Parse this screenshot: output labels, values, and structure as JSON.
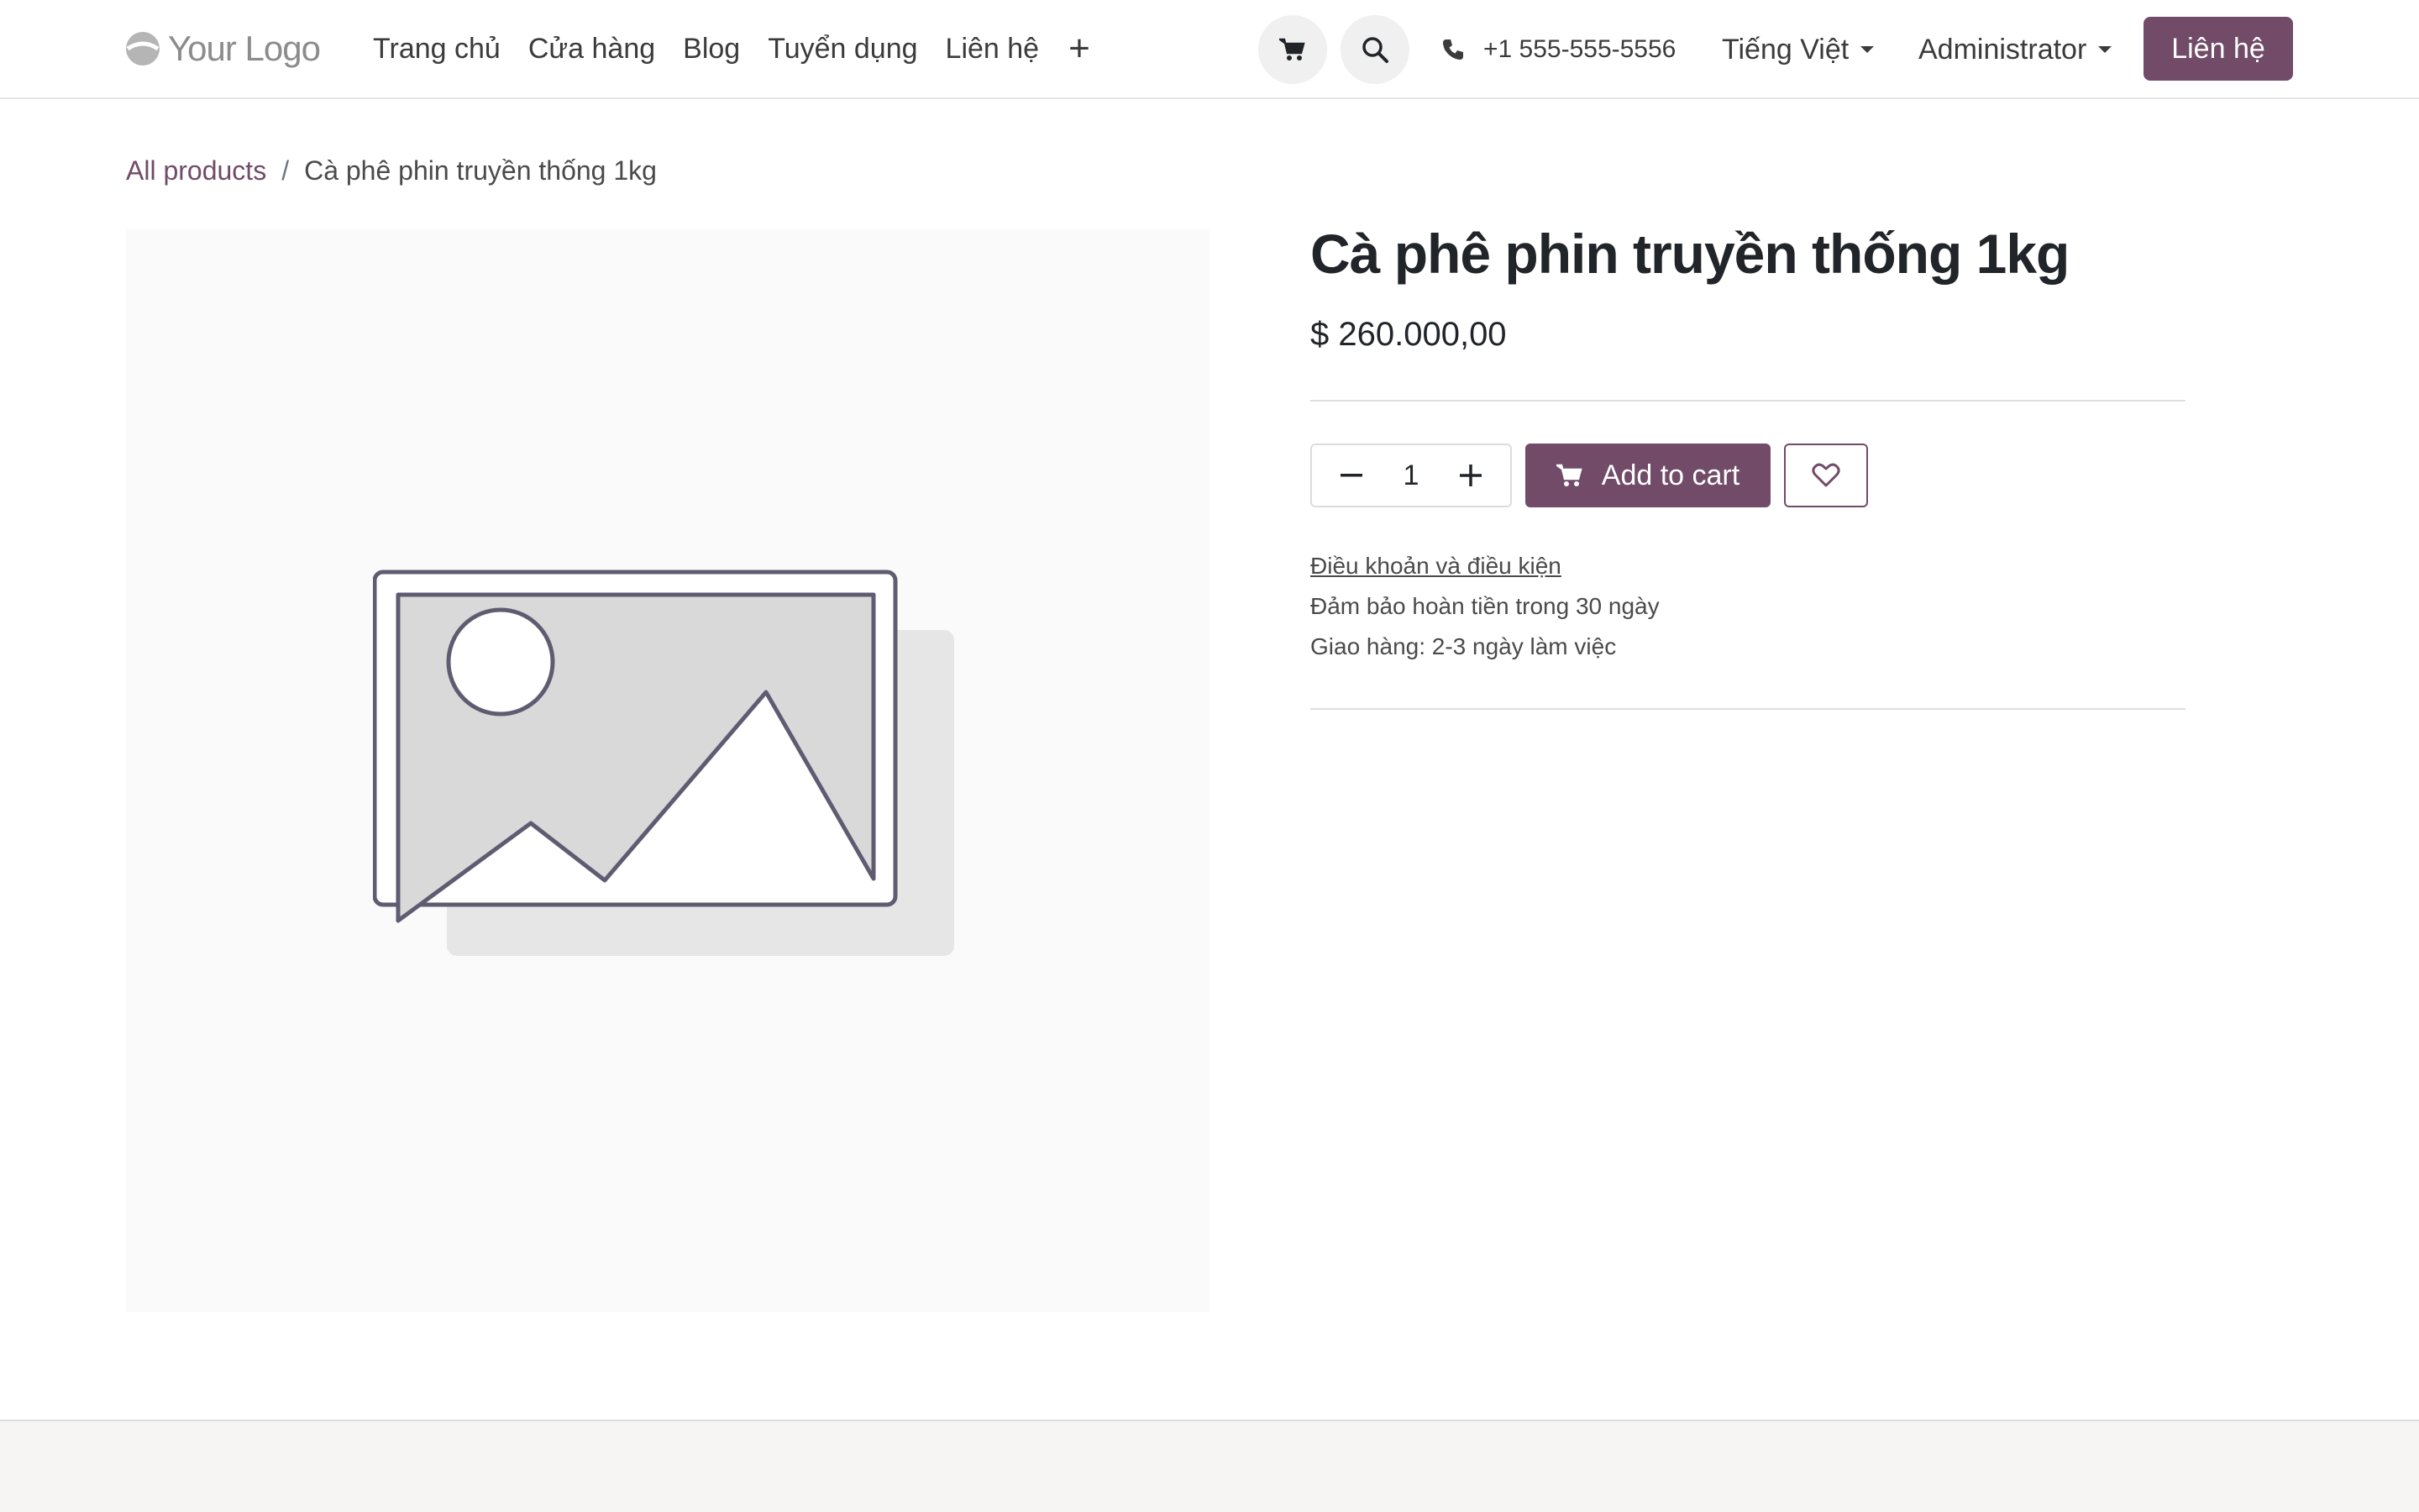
{
  "header": {
    "logo_text": "Your Logo",
    "nav": [
      "Trang chủ",
      "Cửa hàng",
      "Blog",
      "Tuyển dụng",
      "Liên hệ"
    ],
    "nav_add_symbol": "+",
    "phone": "+1 555-555-5556",
    "language": "Tiếng Việt",
    "user": "Administrator",
    "contact_button": "Liên hệ"
  },
  "breadcrumb": {
    "root": "All products",
    "separator": "/",
    "current": "Cà phê phin truyền thống 1kg"
  },
  "product": {
    "title": "Cà phê phin truyền thống 1kg",
    "price": "$ 260.000,00",
    "quantity": "1",
    "add_to_cart": "Add to cart",
    "terms_link": "Điều khoản và điều kiện",
    "guarantee": "Đảm bảo hoàn tiền trong 30 ngày",
    "shipping": "Giao hàng: 2-3 ngày làm việc"
  },
  "icons": {
    "cart": "cart-icon",
    "search": "search-icon",
    "phone": "phone-icon",
    "minus": "minus-icon",
    "plus": "plus-icon",
    "wishlist": "heart-icon",
    "image_placeholder": "image-placeholder-icon",
    "edit_corner": "edit-corner-icon"
  },
  "colors": {
    "brand": "#714b67",
    "text": "#212529",
    "muted": "#4a4a4a",
    "image_bg": "#fafafa",
    "footer_bg": "#f6f5f3"
  }
}
